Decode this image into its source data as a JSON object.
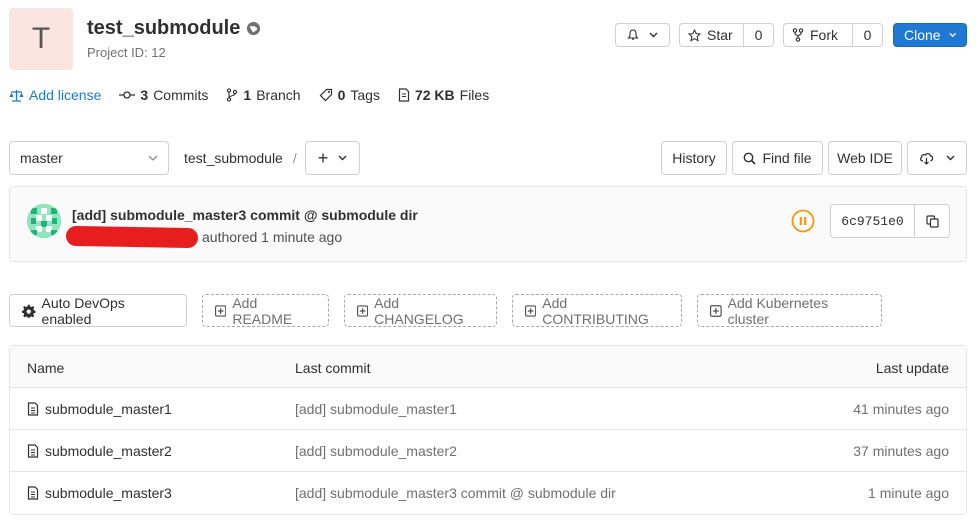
{
  "project": {
    "avatar_letter": "T",
    "name": "test_submodule",
    "id_label": "Project ID: 12",
    "visibility_icon": "globe-icon"
  },
  "header_actions": {
    "notification_icon": "bell-icon",
    "star_label": "Star",
    "star_count": "0",
    "fork_label": "Fork",
    "fork_count": "0",
    "clone_label": "Clone"
  },
  "stats": {
    "license": "Add license",
    "commits_count": "3",
    "commits_label": "Commits",
    "branches_count": "1",
    "branches_label": "Branch",
    "tags_count": "0",
    "tags_label": "Tags",
    "size_value": "72 KB",
    "size_label": "Files"
  },
  "branch_bar": {
    "branch": "master",
    "breadcrumb": "test_submodule",
    "separator": "/",
    "plus": "+",
    "history": "History",
    "find_file": "Find file",
    "web_ide": "Web IDE"
  },
  "last_commit": {
    "title": "[add] submodule_master3 commit @ submodule dir",
    "meta": "authored 1 minute ago",
    "sha": "6c9751e0",
    "pipeline_status": "paused"
  },
  "quick_actions": [
    {
      "label": "Auto DevOps enabled",
      "icon": "gear-icon",
      "style": "solid"
    },
    {
      "label": "Add README",
      "icon": "plus-square-icon",
      "style": "dashed"
    },
    {
      "label": "Add CHANGELOG",
      "icon": "plus-square-icon",
      "style": "dashed"
    },
    {
      "label": "Add CONTRIBUTING",
      "icon": "plus-square-icon",
      "style": "dashed"
    },
    {
      "label": "Add Kubernetes cluster",
      "icon": "plus-square-icon",
      "style": "dashed"
    }
  ],
  "table": {
    "headers": {
      "name": "Name",
      "last_commit": "Last commit",
      "last_update": "Last update"
    },
    "rows": [
      {
        "name": "submodule_master1",
        "commit": "[add] submodule_master1",
        "updated": "41 minutes ago"
      },
      {
        "name": "submodule_master2",
        "commit": "[add] submodule_master2",
        "updated": "37 minutes ago"
      },
      {
        "name": "submodule_master3",
        "commit": "[add] submodule_master3 commit @ submodule dir",
        "updated": "1 minute ago"
      }
    ]
  },
  "colors": {
    "accent": "#1f78d1",
    "pipeline": "#fc9403",
    "avatar_bg": "#fbe5e1"
  }
}
